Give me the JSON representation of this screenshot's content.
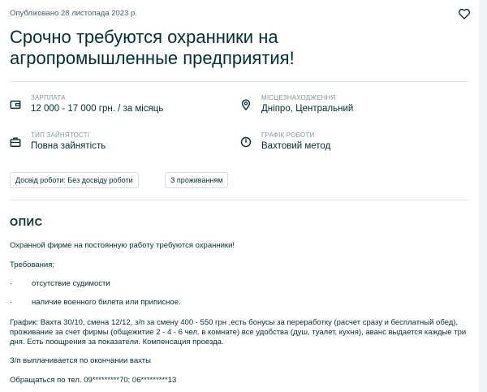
{
  "published": "Опубліковано 28 листопада 2023 р.",
  "title": "Срочно требуются охранники на агропромышленные предприятия!",
  "params": {
    "salary": {
      "label": "ЗАРПЛАТА",
      "value": "12 000 - 17 000 грн. / за місяць"
    },
    "location": {
      "label": "МІСЦЕЗНАХОДЖЕННЯ",
      "value": "Дніпро, Центральний"
    },
    "employment": {
      "label": "ТИП ЗАЙНЯТОСТІ",
      "value": "Повна зайнятість"
    },
    "schedule": {
      "label": "ГРАФІК РОБОТИ",
      "value": "Вахтовий метод"
    }
  },
  "tags": [
    "Досвід роботи: Без досвіду роботи",
    "З проживанням"
  ],
  "description": {
    "heading": "ОПИС",
    "intro": "Охранной фирме на постоянную работу требуются охранники!",
    "requirements_label": "Требования;",
    "bullets": [
      "отсутствие судимости",
      "наличие военного билета или приписное."
    ],
    "bullet_marker": "·",
    "schedule_text": "График: Вахта 30/10, смена 12/12, з/п за смену 400 - 550 грн ,есть бонусы за переработку (расчет сразу и бесплатный обед), проживание за счет фирмы (общежитие 2 - 4 - 6 чел. в комнате) все удобства (душ, туалет, кухня), аванс выдается каждые три дня. Есть поощрения за показатели. Компенсация проезда.",
    "payment_text": "З/п выплачивается по окончании вахты",
    "contact_text": "Обращаться по тел. 09*********70; 06*********13"
  }
}
